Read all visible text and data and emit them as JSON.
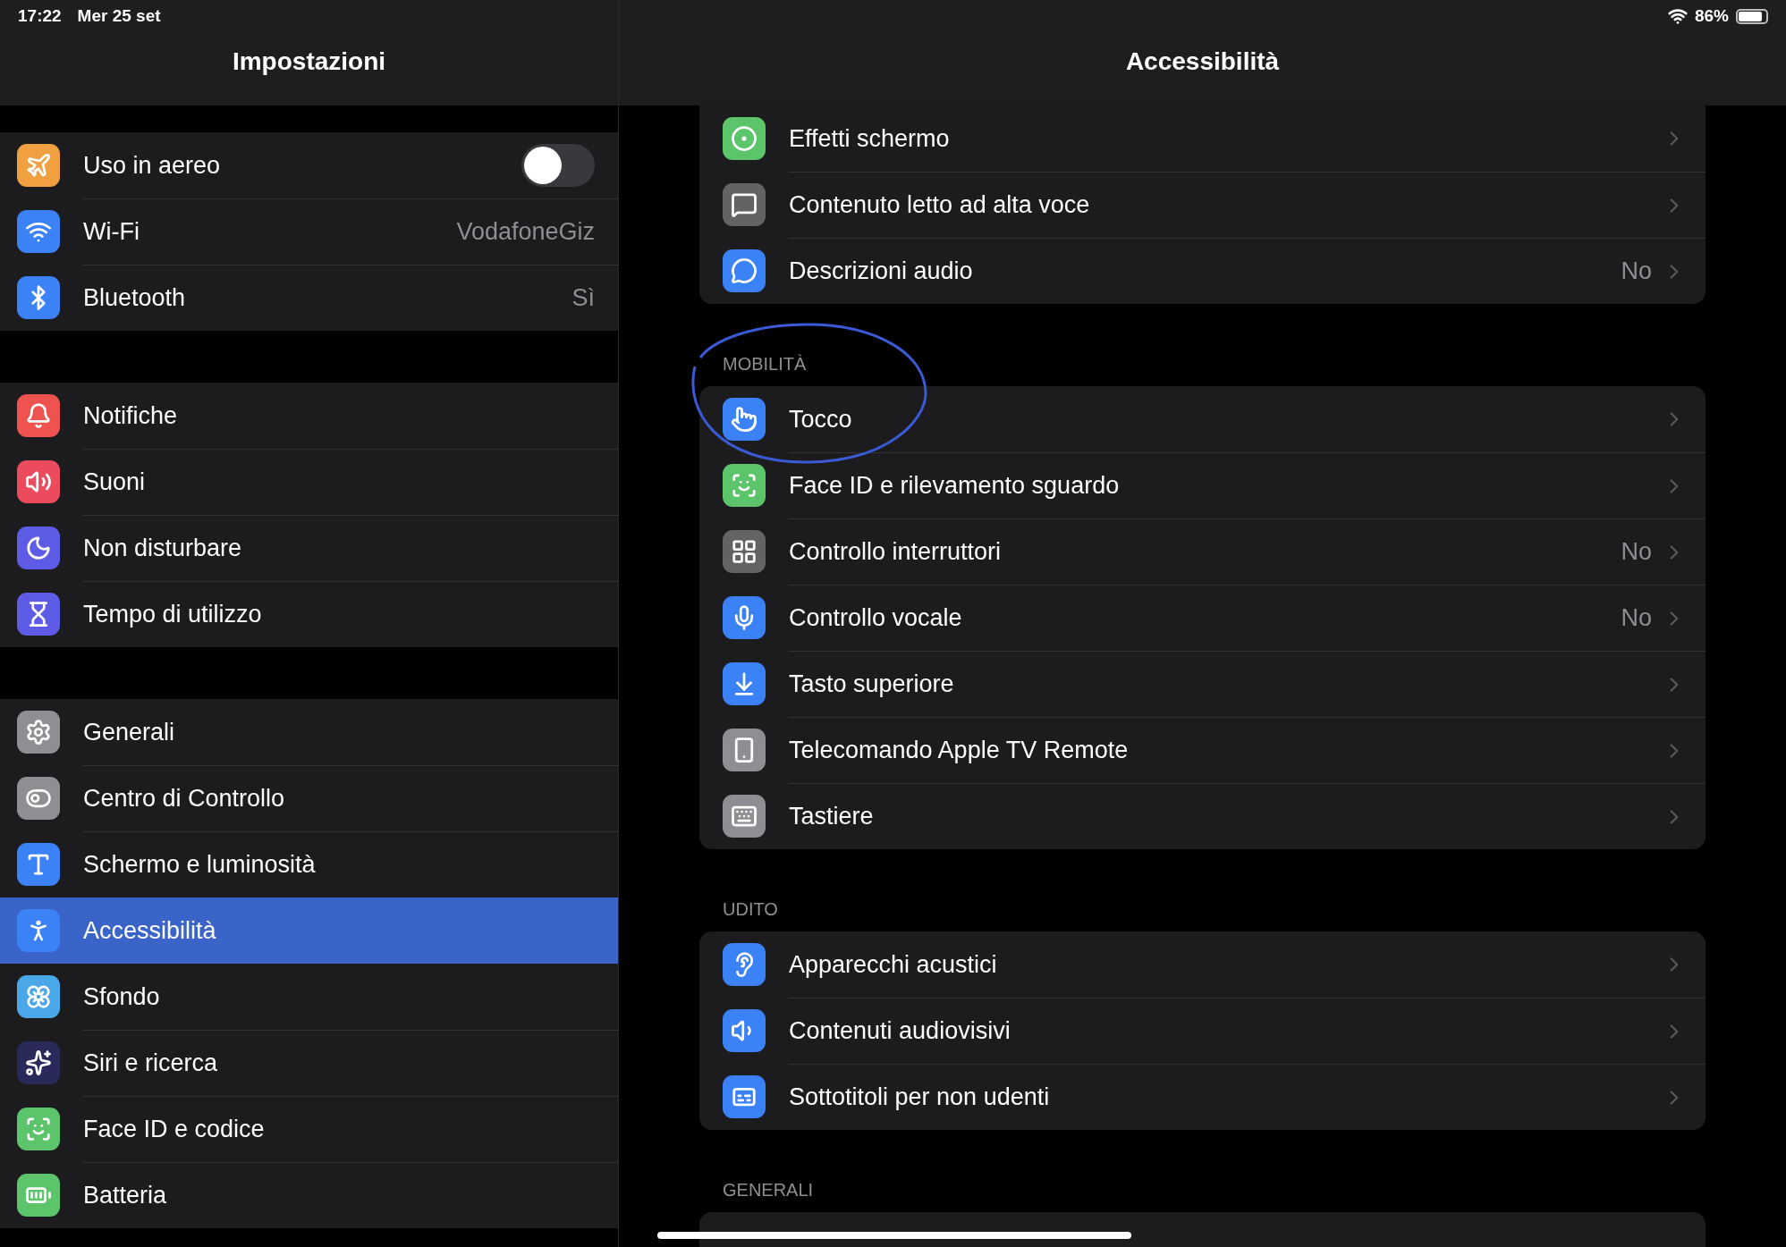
{
  "status_bar": {
    "time": "17:22",
    "date": "Mer 25 set",
    "battery": "86%"
  },
  "sidebar": {
    "title": "Impostazioni",
    "groups": [
      {
        "items": [
          {
            "kind": "toggle",
            "label": "Uso in aereo",
            "on": false,
            "color": "#f0a040",
            "selected": false
          },
          {
            "kind": "link",
            "label": "Wi-Fi",
            "value": "VodafoneGiz",
            "color": "#3b82f6",
            "selected": false
          },
          {
            "kind": "link",
            "label": "Bluetooth",
            "value": "Sì",
            "color": "#3b82f6",
            "selected": false
          }
        ]
      },
      {
        "items": [
          {
            "kind": "link",
            "label": "Notifiche",
            "color": "#ef5350",
            "selected": false
          },
          {
            "kind": "link",
            "label": "Suoni",
            "color": "#ec4b5e",
            "selected": false
          },
          {
            "kind": "link",
            "label": "Non disturbare",
            "color": "#5e5ce6",
            "selected": false
          },
          {
            "kind": "link",
            "label": "Tempo di utilizzo",
            "color": "#5e5ce6",
            "selected": false
          }
        ]
      },
      {
        "items": [
          {
            "kind": "link",
            "label": "Generali",
            "color": "#8e8e93",
            "selected": false
          },
          {
            "kind": "link",
            "label": "Centro di Controllo",
            "color": "#8e8e93",
            "selected": false
          },
          {
            "kind": "link",
            "label": "Schermo e luminosità",
            "color": "#3b82f6",
            "selected": false
          },
          {
            "kind": "link",
            "label": "Accessibilità",
            "color": "#3b82f6",
            "selected": true
          },
          {
            "kind": "link",
            "label": "Sfondo",
            "color": "#4aa8e8",
            "selected": false
          },
          {
            "kind": "link",
            "label": "Siri e ricerca",
            "color": "#2a2a5a",
            "selected": false
          },
          {
            "kind": "link",
            "label": "Face ID e codice",
            "color": "#5cc46a",
            "selected": false
          },
          {
            "kind": "link",
            "label": "Batteria",
            "color": "#5cc46a",
            "selected": false
          }
        ]
      }
    ]
  },
  "detail": {
    "title": "Accessibilità",
    "sections": [
      {
        "rows": [
          {
            "label": "Effetti schermo",
            "color": "#5cc46a"
          },
          {
            "label": "Contenuto letto ad alta voce",
            "color": "#636366"
          },
          {
            "label": "Descrizioni audio",
            "value": "No",
            "color": "#3b82f6"
          }
        ]
      },
      {
        "header": "MOBILITÀ",
        "rows": [
          {
            "label": "Tocco",
            "color": "#3b82f6"
          },
          {
            "label": "Face ID e rilevamento sguardo",
            "color": "#5cc46a"
          },
          {
            "label": "Controllo interruttori",
            "value": "No",
            "color": "#636366"
          },
          {
            "label": "Controllo vocale",
            "value": "No",
            "color": "#3b82f6"
          },
          {
            "label": "Tasto superiore",
            "color": "#3b82f6"
          },
          {
            "label": "Telecomando Apple TV Remote",
            "color": "#8e8e93"
          },
          {
            "label": "Tastiere",
            "color": "#8e8e93"
          }
        ]
      },
      {
        "header": "UDITO",
        "rows": [
          {
            "label": "Apparecchi acustici",
            "color": "#3b82f6"
          },
          {
            "label": "Contenuti audiovisivi",
            "color": "#3b82f6"
          },
          {
            "label": "Sottotitoli per non udenti",
            "color": "#3b82f6"
          }
        ]
      },
      {
        "header": "GENERALI"
      }
    ]
  }
}
